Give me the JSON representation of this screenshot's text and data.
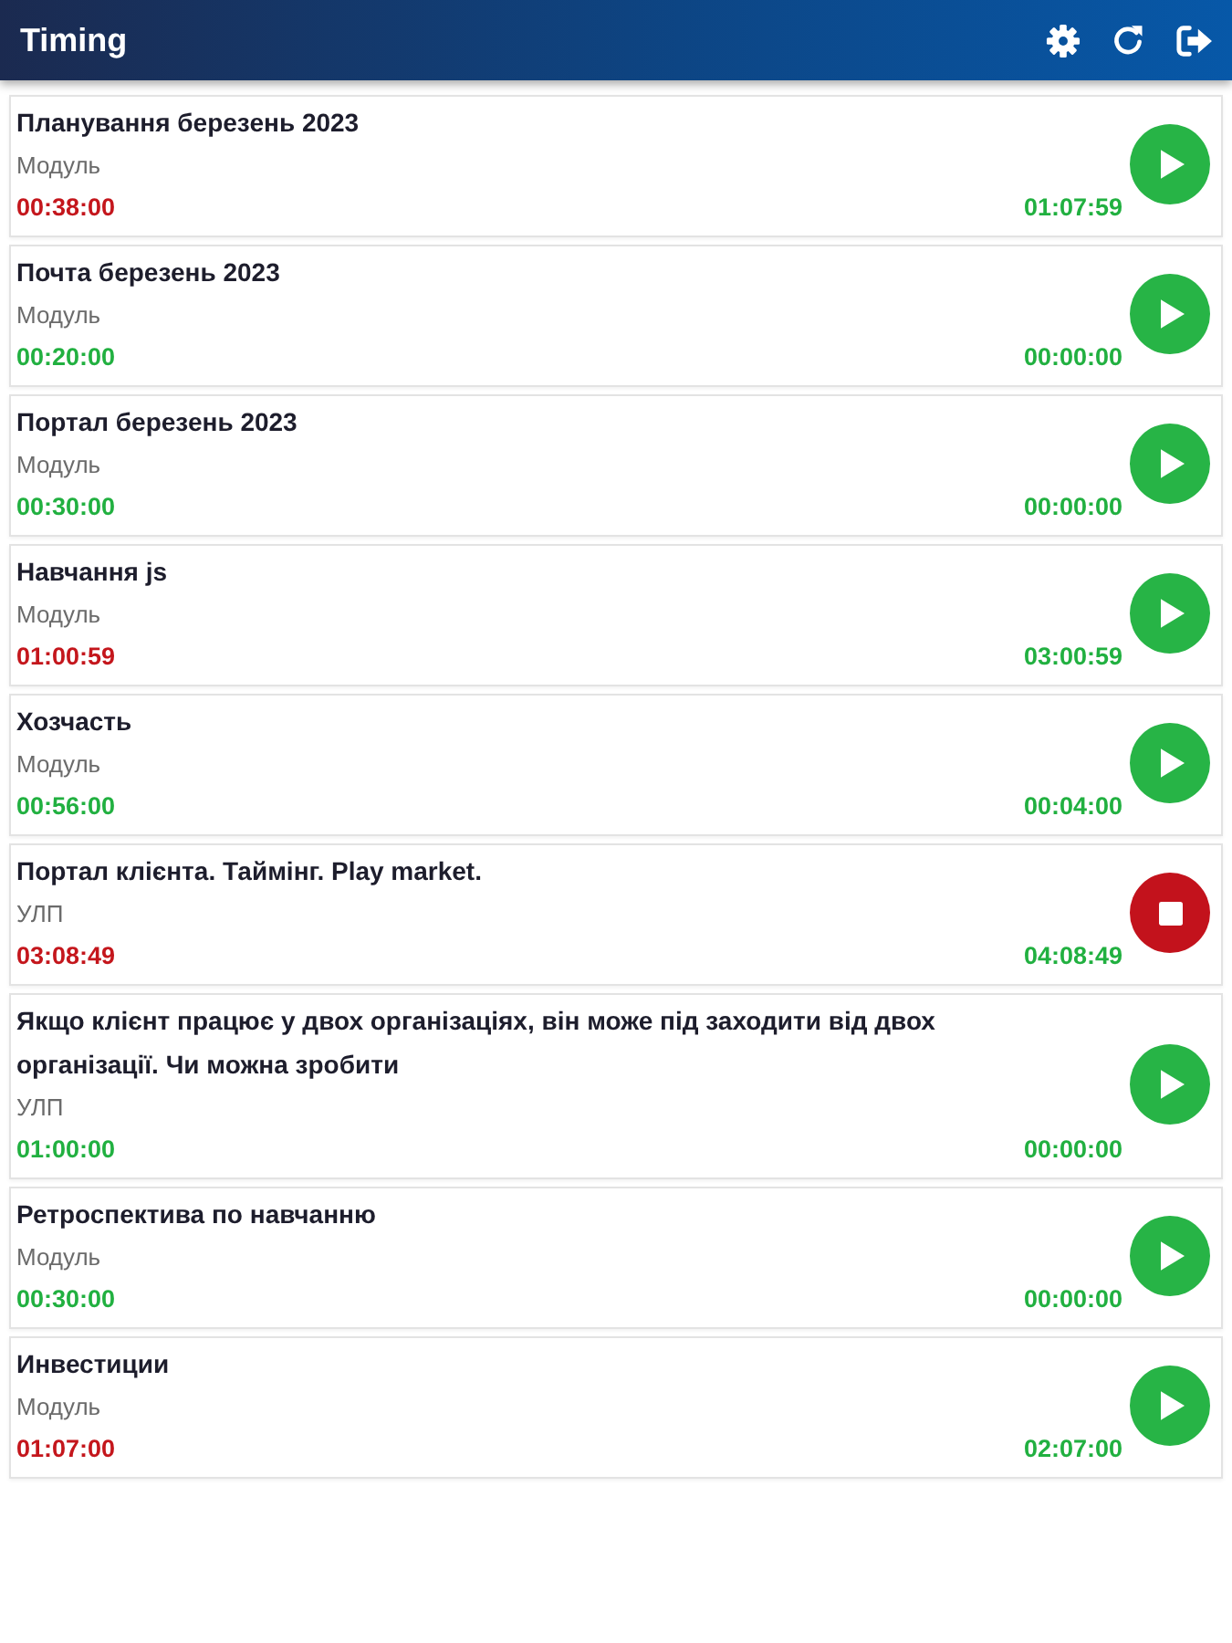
{
  "app_bar": {
    "title": "Timing"
  },
  "tasks": [
    {
      "title": "Планування березень 2023",
      "module": "Модуль",
      "spent": "00:38:00",
      "overdue": true,
      "total": "01:07:59",
      "running": false
    },
    {
      "title": "Почта березень 2023",
      "module": "Модуль",
      "spent": "00:20:00",
      "overdue": false,
      "total": "00:00:00",
      "running": false
    },
    {
      "title": "Портал березень 2023",
      "module": "Модуль",
      "spent": "00:30:00",
      "overdue": false,
      "total": "00:00:00",
      "running": false
    },
    {
      "title": "Навчання js",
      "module": "Модуль",
      "spent": "01:00:59",
      "overdue": true,
      "total": "03:00:59",
      "running": false
    },
    {
      "title": "Хозчасть",
      "module": "Модуль",
      "spent": "00:56:00",
      "overdue": false,
      "total": "00:04:00",
      "running": false
    },
    {
      "title": "Портал клієнта. Таймінг. Play market.",
      "module": "УЛП",
      "spent": "03:08:49",
      "overdue": true,
      "total": "04:08:49",
      "running": true
    },
    {
      "title": "Якщо клієнт працює у двох організаціях, він може під заходити від двох організації. Чи можна зробити",
      "module": "УЛП",
      "spent": "01:00:00",
      "overdue": false,
      "total": "00:00:00",
      "running": false
    },
    {
      "title": "Ретроспектива по навчанню",
      "module": "Модуль",
      "spent": "00:30:00",
      "overdue": false,
      "total": "00:00:00",
      "running": false
    },
    {
      "title": "Инвестиции",
      "module": "Модуль",
      "spent": "01:07:00",
      "overdue": true,
      "total": "02:07:00",
      "running": false
    }
  ]
}
